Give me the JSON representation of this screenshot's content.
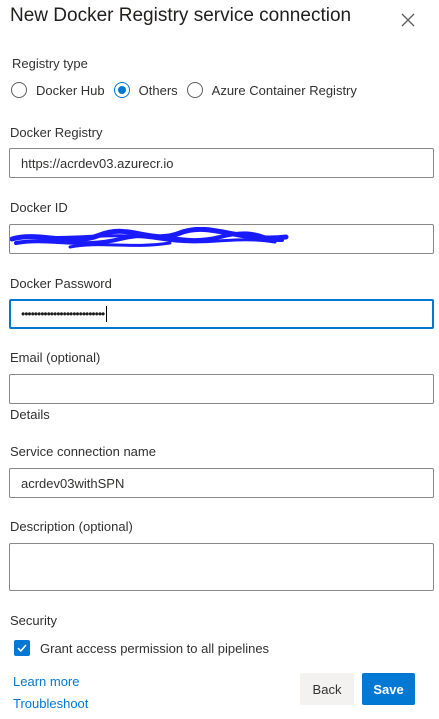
{
  "dialog": {
    "title": "New Docker Registry service connection"
  },
  "registry_type": {
    "label": "Registry type",
    "options": [
      {
        "label": "Docker Hub",
        "selected": false
      },
      {
        "label": "Others",
        "selected": true
      },
      {
        "label": "Azure Container Registry",
        "selected": false
      }
    ]
  },
  "docker_registry": {
    "label": "Docker Registry",
    "value": "https://acrdev03.azurecr.io"
  },
  "docker_id": {
    "label": "Docker ID",
    "value": ""
  },
  "docker_password": {
    "label": "Docker Password",
    "masked_value": "••••••••••••••••••••••••••"
  },
  "email": {
    "label": "Email (optional)",
    "value": ""
  },
  "details": {
    "heading": "Details"
  },
  "service_connection_name": {
    "label": "Service connection name",
    "value": "acrdev03withSPN"
  },
  "description": {
    "label": "Description (optional)",
    "value": ""
  },
  "security": {
    "heading": "Security",
    "grant_access_label": "Grant access permission to all pipelines",
    "grant_access_checked": true
  },
  "links": {
    "learn_more": "Learn more",
    "troubleshoot": "Troubleshoot"
  },
  "buttons": {
    "back": "Back",
    "save": "Save"
  },
  "colors": {
    "accent": "#0078d4",
    "redaction": "#1a1aff"
  }
}
